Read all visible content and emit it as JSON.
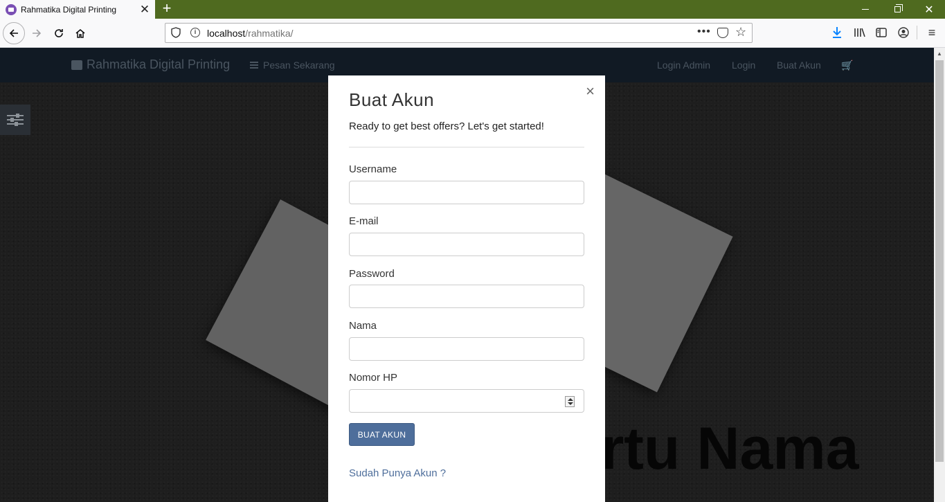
{
  "browser": {
    "tab_title": "Rahmatika Digital Printing",
    "tab_close": "✕",
    "new_tab": "+",
    "url_host": "localhost",
    "url_path": "/rahmatika/",
    "page_actions": "•••",
    "star": "☆",
    "menu": "≡"
  },
  "site_nav": {
    "brand": "Rahmatika Digital Printing",
    "pesan": "Pesan Sekarang",
    "links": [
      "Login Admin",
      "Login",
      "Buat Akun"
    ],
    "cart": "🛒"
  },
  "hero": {
    "headline_fragment": "artu Nama"
  },
  "modal": {
    "close": "×",
    "title": "Buat Akun",
    "subtitle": "Ready to get best offers? Let's get started!",
    "fields": [
      {
        "label": "Username",
        "value": ""
      },
      {
        "label": "E-mail",
        "value": ""
      },
      {
        "label": "Password",
        "value": ""
      },
      {
        "label": "Nama",
        "value": ""
      },
      {
        "label": "Nomor HP",
        "value": ""
      }
    ],
    "submit": "BUAT AKUN",
    "login_link": "Sudah Punya Akun ?"
  }
}
